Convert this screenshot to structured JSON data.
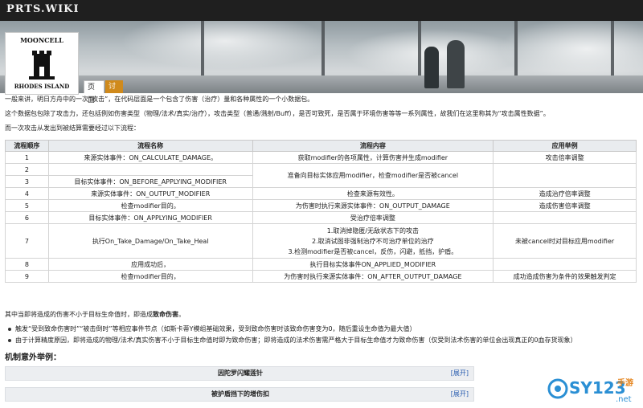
{
  "site": {
    "brand": "PRTS.WIKI"
  },
  "logo": {
    "top_text": "MOONCELL",
    "bottom_text": "RHODES ISLAND"
  },
  "tabs": [
    {
      "label": "页面"
    },
    {
      "label": "讨论"
    }
  ],
  "intro": [
    "一般来讲，明日方舟中的一次“攻击”，在代码层面是一个包含了伤害（治疗）量和各种属性的一个小数据包。",
    "这个数据包包除了攻击力，还包括例如伤害类型（物理/法术/真实/治疗），攻击类型（普通/溅射/Buff），是否可致死，是否属于环境伤害等等一系列属性，故我们在这里称其为“攻击属性数据”。",
    "而一次攻击从发出到被结算需要经过以下流程："
  ],
  "table": {
    "headers": [
      "流程顺序",
      "流程名称",
      "流程内容",
      "应用举例"
    ],
    "rows": [
      {
        "order": "1",
        "name": "来源实体事件：ON_CALCULATE_DAMAGE。",
        "content": [
          "获取modifier的各项属性，计算伤害并生成modifier"
        ],
        "example": "攻击倍率调整"
      },
      {
        "order": "2",
        "name": "",
        "content": [
          "准备向目标实体应用modifier，检查modifier是否被cancel"
        ],
        "example": ""
      },
      {
        "order": "3",
        "name": "目标实体事件：ON_BEFORE_APPLYING_MODIFIER",
        "content": [
          ""
        ],
        "example": ""
      },
      {
        "order": "4",
        "name": "来源实体事件：ON_OUTPUT_MODIFIER",
        "content": [
          "检查来源有效性。"
        ],
        "example": "造成治疗倍率调整"
      },
      {
        "order": "5",
        "name": "检查modifier目的。",
        "content": [
          "为伤害时执行来源实体事件：ON_OUTPUT_DAMAGE"
        ],
        "example": "造成伤害倍率调整"
      },
      {
        "order": "6",
        "name": "目标实体事件：ON_APPLYING_MODIFIER",
        "content": [
          "受治疗倍率调整"
        ],
        "example": ""
      },
      {
        "order": "7",
        "name": "执行On_Take_Damage/On_Take_Heal",
        "content": [
          "1.取消掉隐匿/无敌状态下的攻击",
          "2.取消试图非强制治疗不可治疗单位的治疗",
          "3.检测modifier是否被cancel，反伤，闪避，抵挡，护盾。"
        ],
        "example": "未被cancel时对目标应用modifier"
      },
      {
        "order": "8",
        "name": "应用成功后，",
        "content": [
          "执行目标实体事件ON_APPLIED_MODIFIER"
        ],
        "example": ""
      },
      {
        "order": "9",
        "name": "检查modifier目的，",
        "content": [
          "为伤害时执行来源实体事件：ON_AFTER_OUTPUT_DAMAGE"
        ],
        "example": "成功造成伤害为条件的效果触发判定"
      }
    ]
  },
  "after": {
    "lead": "其中当即将造成的伤害不小于目标生命值时，即造成",
    "strong": "致命伤害",
    "tail": "。"
  },
  "bullets": [
    "触发“受到致命伤害时”“被击倒时”等相应事件节点（如斯卡蒂Y模组基础效果，受到致命伤害时该致命伤害变为0，随后重设生命值为最大值）",
    "由于计算精度原因，即将造成的物理/法术/真实伤害不小于目标生命值时即为致命伤害；即将造成的法术伤害需严格大于目标生命值才为致命伤害（仅受到法术伤害的单位会出现真正的0血存货现象）"
  ],
  "section": {
    "title": "机制意外举例："
  },
  "collapsibles": [
    {
      "title": "因陀罗闪耀莲针",
      "expand": "[展开]"
    },
    {
      "title": "被护盾挡下的增伤扣",
      "expand": "[展开]"
    }
  ],
  "watermark": {
    "text": "SY123",
    "sub": "手游",
    "domain": ".net"
  },
  "colors": {
    "talk_tab": "#d08a1c",
    "link": "#2a5db0",
    "header_bg": "#e9ecef"
  }
}
